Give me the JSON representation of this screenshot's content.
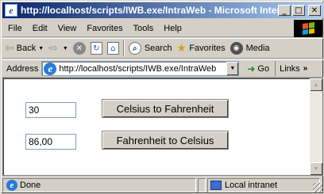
{
  "window": {
    "title": "http://localhost/scripts/IWB.exe/IntraWeb - Microsoft Internet Explorer",
    "title_icon": "ie-icon",
    "controls": {
      "minimize": "_",
      "maximize": "□",
      "close": "✕"
    }
  },
  "menubar": {
    "items": [
      {
        "label": "File"
      },
      {
        "label": "Edit"
      },
      {
        "label": "View"
      },
      {
        "label": "Favorites"
      },
      {
        "label": "Tools"
      },
      {
        "label": "Help"
      }
    ]
  },
  "toolbar": {
    "back_label": "Back",
    "search_label": "Search",
    "favorites_label": "Favorites",
    "media_label": "Media"
  },
  "address_bar": {
    "label": "Address",
    "url": "http://localhost/scripts/IWB.exe/IntraWeb",
    "go_label": "Go",
    "links_label": "Links"
  },
  "page": {
    "celsius_value": "30",
    "c2f_button": "Celsius to Fahrenheit",
    "fahrenheit_value": "86,00",
    "f2c_button": "Fahrenheit to Celsius"
  },
  "statusbar": {
    "status_text": "Done",
    "zone_text": "Local intranet"
  },
  "colors": {
    "title_gradient_start": "#0a246a",
    "title_gradient_end": "#a6caf0",
    "chrome": "#d4d0c8"
  }
}
